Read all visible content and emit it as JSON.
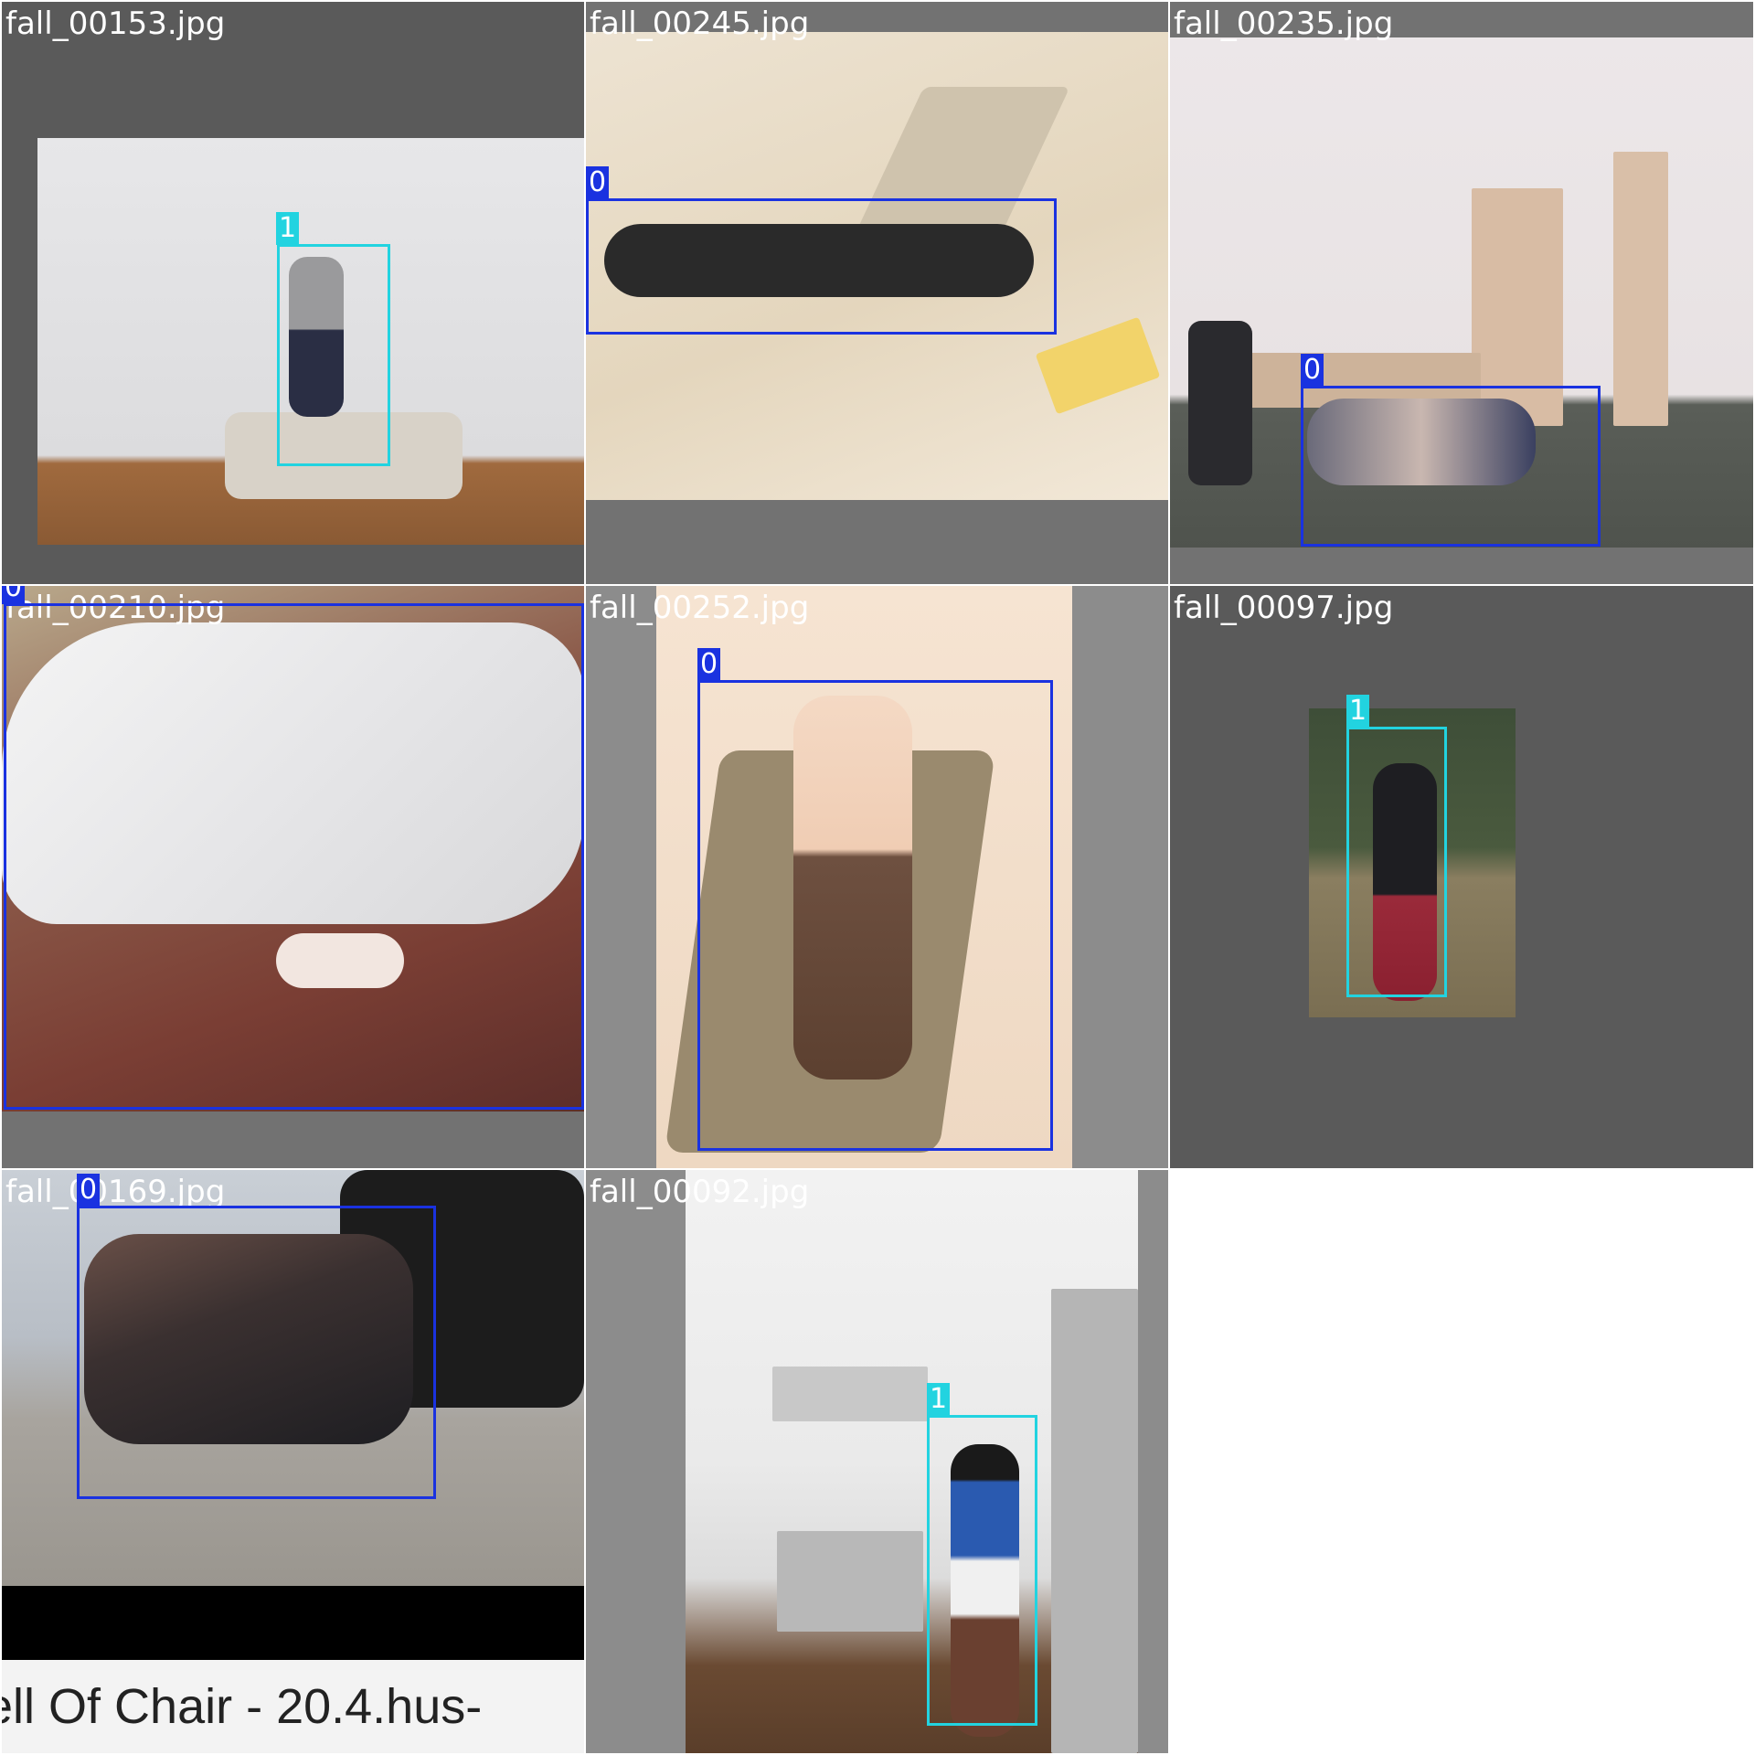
{
  "palette": {
    "class_0": "#1a32e0",
    "class_1": "#22d3e0"
  },
  "tiles": [
    {
      "file": "fall_00153.jpg",
      "label": "1"
    },
    {
      "file": "fall_00245.jpg",
      "label": "0"
    },
    {
      "file": "fall_00235.jpg",
      "label": "0"
    },
    {
      "file": "fall_00210.jpg",
      "label": "0"
    },
    {
      "file": "fall_00252.jpg",
      "label": "0"
    },
    {
      "file": "fall_00097.jpg",
      "label": "1"
    },
    {
      "file": "fall_00169.jpg",
      "label": "0",
      "caption": "ell Of Chair - 20.4.hus-"
    },
    {
      "file": "fall_00092.jpg",
      "label": "1"
    }
  ]
}
